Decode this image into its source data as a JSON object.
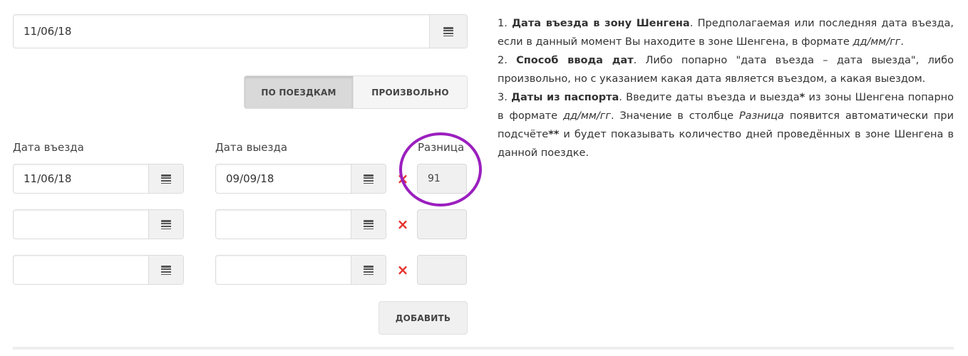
{
  "schengen_entry": {
    "value": "11/06/18"
  },
  "mode": {
    "by_trips_label": "ПО ПОЕЗДКАМ",
    "arbitrary_label": "ПРОИЗВОЛЬНО"
  },
  "columns": {
    "entry": "Дата въезда",
    "exit": "Дата выезда",
    "diff": "Разница"
  },
  "rows": [
    {
      "entry": "11/06/18",
      "exit": "09/09/18",
      "diff": "91"
    },
    {
      "entry": "",
      "exit": "",
      "diff": ""
    },
    {
      "entry": "",
      "exit": "",
      "diff": ""
    }
  ],
  "add_button": "ДОБАВИТЬ",
  "delete_icon": "×",
  "icons": {
    "calendar": "calendar-icon",
    "delete": "delete-icon"
  },
  "colors": {
    "delete": "#e5322d",
    "highlight_circle": "#9b1fbf"
  },
  "help": {
    "p1_num": "1. ",
    "p1_bold": "Дата въезда в зону Шенгена",
    "p1_text1": ". Предполагаемая или последняя дата въезда, если в данный момент Вы находите в зоне Шенгена, в формате ",
    "p1_italic": "дд/мм/гг",
    "p1_text2": ".",
    "p2_num": "2. ",
    "p2_bold": "Способ ввода дат",
    "p2_text": ". Либо попарно \"дата въезда – дата выезда\", либо произвольно, но с указанием какая дата является въездом, а какая выездом.",
    "p3_num": "3. ",
    "p3_bold": "Даты из паспорта",
    "p3_text1": ". Введите даты въезда и выезда",
    "p3_star1": "*",
    "p3_text2": " из зоны Шенгена попарно в формате ",
    "p3_italic1": "дд/мм/гг",
    "p3_text3": ". Значение в столбце ",
    "p3_italic2": "Разница",
    "p3_text4": " появится автоматически при подсчёте",
    "p3_star2": "**",
    "p3_text5": " и будет показывать количество дней проведённых в зоне Шенгена в данной поездке."
  }
}
